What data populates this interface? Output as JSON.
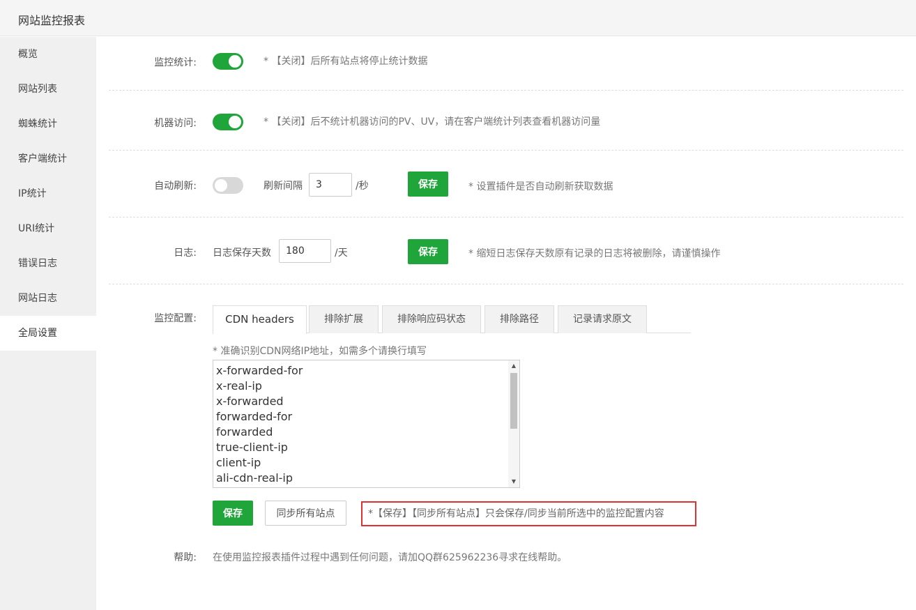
{
  "app": {
    "title": "网站监控报表"
  },
  "sidebar": {
    "items": [
      {
        "label": "概览"
      },
      {
        "label": "网站列表"
      },
      {
        "label": "蜘蛛统计"
      },
      {
        "label": "客户端统计"
      },
      {
        "label": "IP统计"
      },
      {
        "label": "URI统计"
      },
      {
        "label": "错误日志"
      },
      {
        "label": "网站日志"
      },
      {
        "label": "全局设置"
      }
    ],
    "active": "全局设置"
  },
  "settings": {
    "monitor_stats": {
      "label": "监控统计:",
      "enabled": true,
      "note": "* 【关闭】后所有站点将停止统计数据"
    },
    "robot_visit": {
      "label": "机器访问:",
      "enabled": true,
      "note": "* 【关闭】后不统计机器访问的PV、UV，请在客户端统计列表查看机器访问量"
    },
    "auto_refresh": {
      "label": "自动刷新:",
      "enabled": false,
      "interval_label": "刷新间隔",
      "interval_value": "3",
      "unit": "/秒",
      "save_label": "保存",
      "note": "* 设置插件是否自动刷新获取数据"
    },
    "log": {
      "label": "日志:",
      "days_label": "日志保存天数",
      "days_value": "180",
      "unit": "/天",
      "save_label": "保存",
      "note": "* 缩短日志保存天数原有记录的日志将被删除，请谨慎操作"
    },
    "monitor_config": {
      "label": "监控配置:",
      "tabs": [
        {
          "label": "CDN headers"
        },
        {
          "label": "排除扩展"
        },
        {
          "label": "排除响应码状态"
        },
        {
          "label": "排除路径"
        },
        {
          "label": "记录请求原文"
        }
      ],
      "active_tab": "CDN headers",
      "hint": "* 准确识别CDN网络IP地址，如需多个请换行填写",
      "headers": [
        "x-forwarded-for",
        "x-real-ip",
        "x-forwarded",
        "forwarded-for",
        "forwarded",
        "true-client-ip",
        "client-ip",
        "ali-cdn-real-ip"
      ],
      "save_label": "保存",
      "sync_label": "同步所有站点",
      "warning": "*【保存】【同步所有站点】只会保存/同步当前所选中的监控配置内容"
    },
    "help": {
      "label": "帮助:",
      "text": "在使用监控报表插件过程中遇到任何问题，请加QQ群625962236寻求在线帮助。"
    }
  },
  "colors": {
    "accent": "#20a53a",
    "warning_border": "#e03131"
  },
  "icons": {
    "scroll_up": "scroll-up-arrow-icon",
    "scroll_down": "scroll-down-arrow-icon"
  }
}
